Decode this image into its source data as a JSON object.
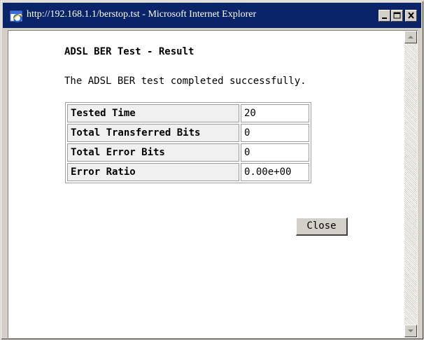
{
  "window": {
    "title": "http://192.168.1.1/berstop.tst - Microsoft Internet Explorer",
    "icon": "ie-icon",
    "controls": [
      "minimize-icon",
      "maximize-icon",
      "close-icon"
    ]
  },
  "page": {
    "heading": "ADSL BER Test - Result",
    "message": "The ADSL BER test completed successfully.",
    "results": [
      {
        "label": "Tested Time",
        "value": "20"
      },
      {
        "label": "Total Transferred Bits",
        "value": "0"
      },
      {
        "label": "Total Error Bits",
        "value": "0"
      },
      {
        "label": "Error Ratio",
        "value": "0.00e+00"
      }
    ],
    "close_label": "Close"
  },
  "colors": {
    "titlebar": "#0a246a",
    "chrome": "#d4d0c8"
  }
}
